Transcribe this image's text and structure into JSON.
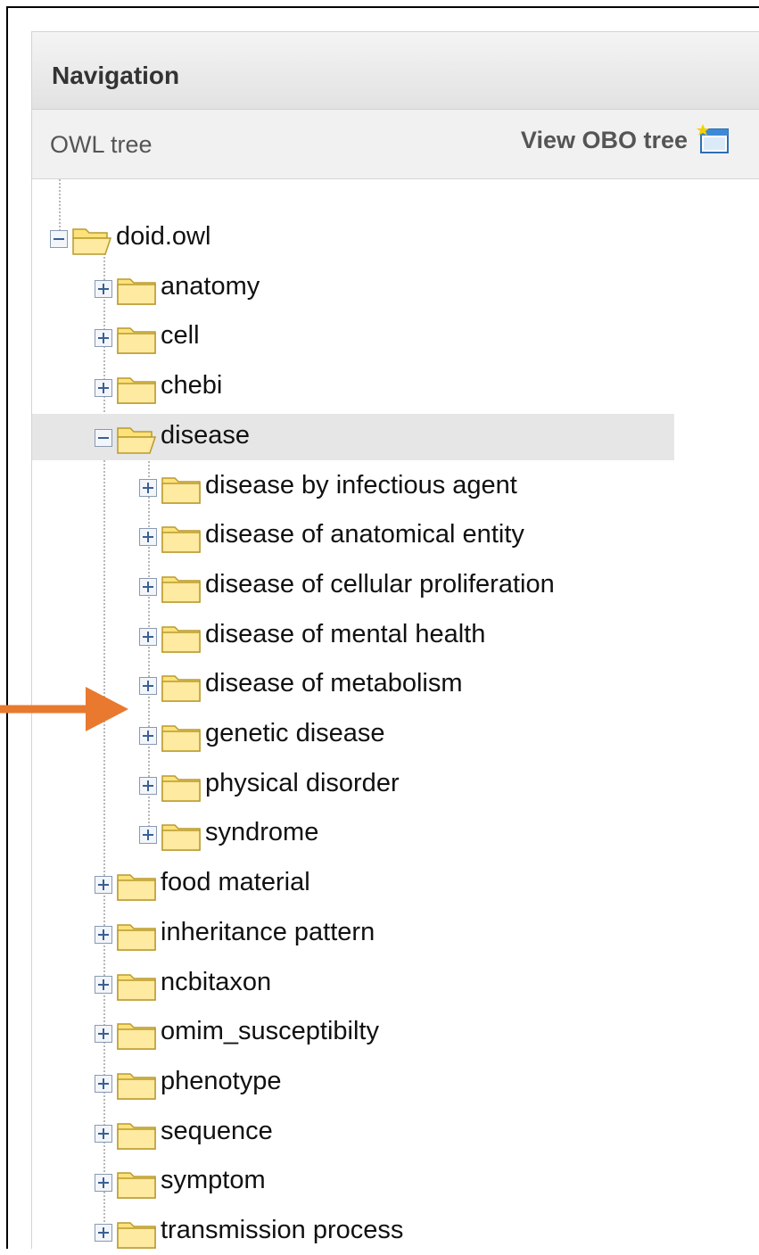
{
  "navigation": {
    "title": "Navigation",
    "owl_tree_label": "OWL tree",
    "obo_tree_link": "View OBO tree"
  },
  "tree": {
    "root": {
      "label": "doid.owl",
      "expanded": true
    },
    "level1_before": [
      "anatomy",
      "cell",
      "chebi"
    ],
    "expanded_node": {
      "label": "disease",
      "expanded": true,
      "selected": true
    },
    "disease_children": [
      "disease by infectious agent",
      "disease of anatomical entity",
      "disease of cellular proliferation",
      "disease of mental health",
      "disease of metabolism",
      "genetic disease",
      "physical disorder",
      "syndrome"
    ],
    "level1_after": [
      "food material",
      "inheritance pattern",
      "ncbitaxon",
      "omim_susceptibilty",
      "phenotype",
      "sequence",
      "symptom",
      "transmission process"
    ]
  },
  "annotation": {
    "arrow_color": "#E8792F",
    "points_to": "genetic disease"
  },
  "colors": {
    "header_bg": "#E6E6E6",
    "subbar_bg": "#F1F1F1",
    "selected_row_bg": "#E6E6E6",
    "folder_fill": "#FDE27A",
    "toggle_blue": "#4A6FA5"
  }
}
